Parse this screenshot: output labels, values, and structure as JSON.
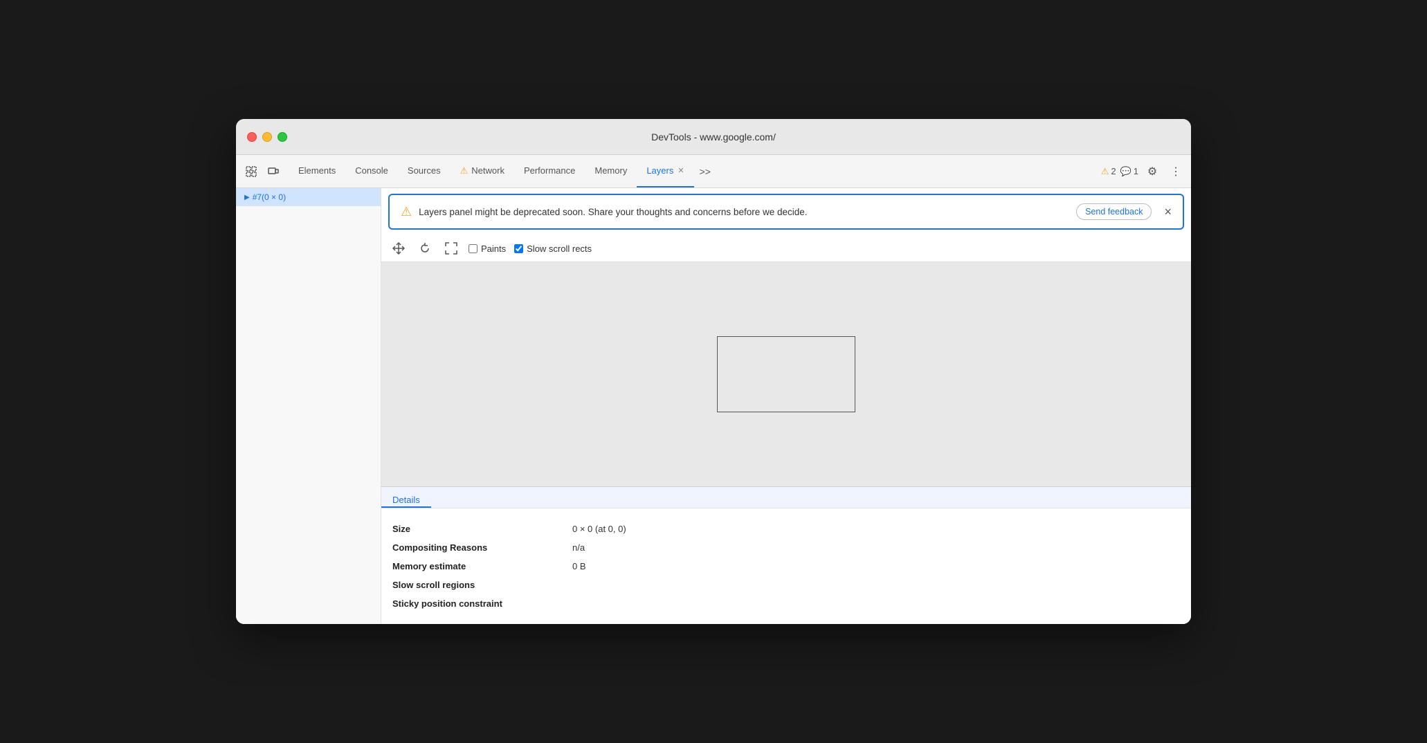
{
  "window": {
    "title": "DevTools - www.google.com/"
  },
  "traffic_lights": {
    "red_label": "close",
    "yellow_label": "minimize",
    "green_label": "maximize"
  },
  "toolbar": {
    "icon1": "⠿",
    "icon2": "⬜",
    "tabs": [
      {
        "id": "elements",
        "label": "Elements",
        "active": false,
        "warning": false
      },
      {
        "id": "console",
        "label": "Console",
        "active": false,
        "warning": false
      },
      {
        "id": "sources",
        "label": "Sources",
        "active": false,
        "warning": false
      },
      {
        "id": "network",
        "label": "Network",
        "active": false,
        "warning": true
      },
      {
        "id": "performance",
        "label": "Performance",
        "active": false,
        "warning": false
      },
      {
        "id": "memory",
        "label": "Memory",
        "active": false,
        "warning": false
      },
      {
        "id": "layers",
        "label": "Layers",
        "active": true,
        "warning": false,
        "closeable": true
      }
    ],
    "overflow": ">>",
    "warning_count": "2",
    "info_count": "1"
  },
  "banner": {
    "message": "Layers panel might be deprecated soon. Share your thoughts and concerns before we decide.",
    "feedback_btn": "Send feedback",
    "close_label": "×"
  },
  "layers_toolbar": {
    "move_icon": "✛",
    "rotate_icon": "↺",
    "fit_icon": "⤢",
    "paints_label": "Paints",
    "paints_checked": false,
    "slow_scroll_label": "Slow scroll rects",
    "slow_scroll_checked": true
  },
  "details": {
    "header": "Details",
    "rows": [
      {
        "key": "Size",
        "value": "0 × 0 (at 0, 0)"
      },
      {
        "key": "Compositing Reasons",
        "value": "n/a"
      },
      {
        "key": "Memory estimate",
        "value": "0 B"
      },
      {
        "key": "Slow scroll regions",
        "value": ""
      },
      {
        "key": "Sticky position constraint",
        "value": ""
      }
    ]
  },
  "sidebar": {
    "item_label": "#7(0 × 0)"
  }
}
